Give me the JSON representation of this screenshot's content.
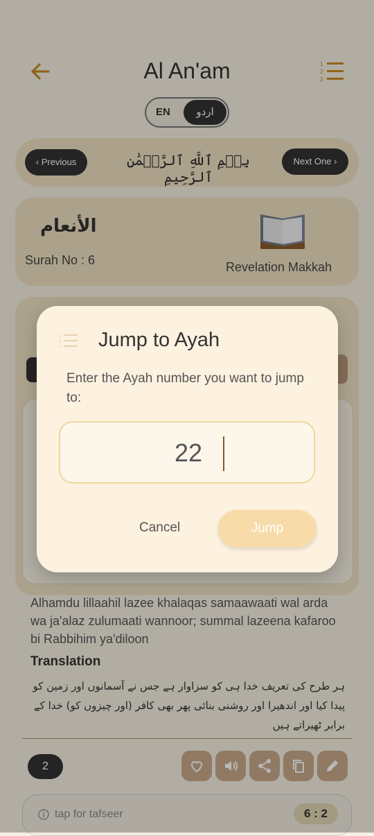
{
  "header": {
    "back_icon": "arrow-left-icon",
    "title": "Al An'am",
    "list_icon": "numbered-list-icon"
  },
  "language_toggle": {
    "en_label": "EN",
    "ur_label": "اردو",
    "selected": "ur"
  },
  "nav": {
    "previous_label": "Previous",
    "next_label": "Next One",
    "bismillah": "بِسۡمِ ٱللَّهِ ٱلرَّحۡمَٰنِ ٱلرَّحِيمِ"
  },
  "surah": {
    "arabic_name": "الأنعام",
    "surah_no": "Surah No : 6",
    "revelation": "Revelation Makkah",
    "icon": "open-book-icon"
  },
  "ayah": {
    "transliteration": "Alhamdu lillaahil lazee khalaqas samaawaati wal arda wa ja'alaz zulumaati wannoor; summal lazeena kafaroo bi Rabbihim ya'diloon",
    "translation_heading": "Translation",
    "translation_urdu": "ہر طرح کی تعریف خدا ہی کو سزاوار ہے جس نے آسمانوں اور زمین کو پیدا کیا اور اندھیرا اور روشنی بنائی پھر بھی کافر (اور چیزوں کو) خدا کے برابر ٹھیراتے ہیں",
    "number": "2",
    "reference": "6 : 2",
    "tafseer_label": "tap for tafseer",
    "actions": [
      "heart-icon",
      "speaker-icon",
      "share-icon",
      "copy-icon",
      "edit-icon"
    ]
  },
  "dialog": {
    "title": "Jump to Ayah",
    "message": "Enter the Ayah number you want to jump to:",
    "input_value": "22",
    "cancel_label": "Cancel",
    "jump_label": "Jump"
  },
  "colors": {
    "accent": "#c98a22",
    "card": "#efe1c2",
    "dialog": "#fdf1df",
    "jump_button": "#f7dcaa"
  }
}
